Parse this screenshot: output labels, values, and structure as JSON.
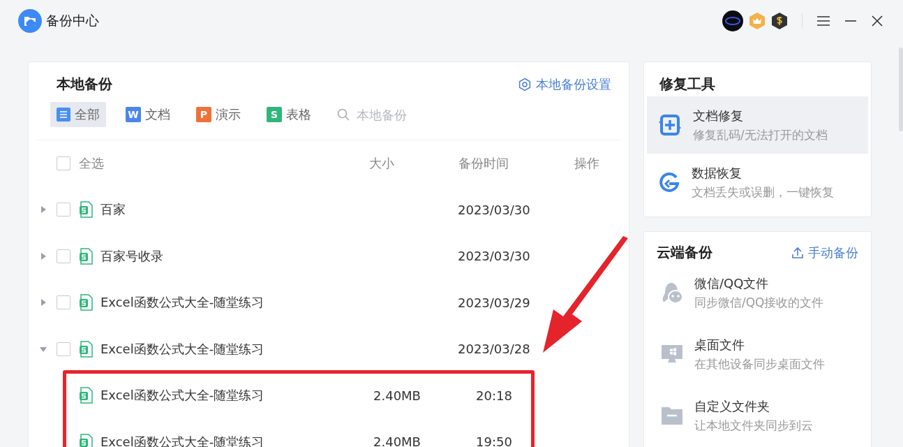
{
  "window": {
    "title": "备份中心"
  },
  "local_backup": {
    "title": "本地备份",
    "settings_link": "本地备份设置",
    "filters": [
      {
        "kind": "all",
        "label": "全部",
        "selected": true
      },
      {
        "kind": "doc",
        "badge": "W",
        "label": "文档",
        "selected": false
      },
      {
        "kind": "ppt",
        "badge": "P",
        "label": "演示",
        "selected": false
      },
      {
        "kind": "sheet",
        "badge": "S",
        "label": "表格",
        "selected": false
      }
    ],
    "search": {
      "placeholder": "本地备份"
    },
    "table": {
      "select_all": {
        "label": "全选",
        "checked": false
      },
      "columns": [
        "大小",
        "备份时间",
        "操作"
      ],
      "rows": [
        {
          "name": "百家",
          "time": "2023/03/30",
          "checked": false,
          "expanded": false
        },
        {
          "name": "百家号收录",
          "time": "2023/03/30",
          "checked": false,
          "expanded": false
        },
        {
          "name": "Excel函数公式大全-随堂练习",
          "time": "2023/03/29",
          "checked": false,
          "expanded": false
        },
        {
          "name": "Excel函数公式大全-随堂练习",
          "time": "2023/03/28",
          "checked": false,
          "expanded": true,
          "children": [
            {
              "name": "Excel函数公式大全-随堂练习",
              "size": "2.40MB",
              "time": "20:18"
            },
            {
              "name": "Excel函数公式大全-随堂练习",
              "size": "2.40MB",
              "time": "19:50"
            }
          ]
        }
      ]
    }
  },
  "repair_tools": {
    "title": "修复工具",
    "items": [
      {
        "kind": "doc-repair",
        "title": "文档修复",
        "subtitle": "修复乱码/无法打开的文档",
        "selected": true
      },
      {
        "kind": "data-recovery",
        "title": "数据恢复",
        "subtitle": "文档丢失或误删，一键恢复",
        "selected": false
      }
    ]
  },
  "cloud_backup": {
    "title": "云端备份",
    "action": "手动备份",
    "items": [
      {
        "kind": "chat",
        "title": "微信/QQ文件",
        "subtitle": "同步微信/QQ接收的文件"
      },
      {
        "kind": "desktop",
        "title": "桌面文件",
        "subtitle": "在其他设备同步桌面文件"
      },
      {
        "kind": "folder",
        "title": "自定义文件夹",
        "subtitle": "让本地文件夹同步到云"
      }
    ]
  }
}
